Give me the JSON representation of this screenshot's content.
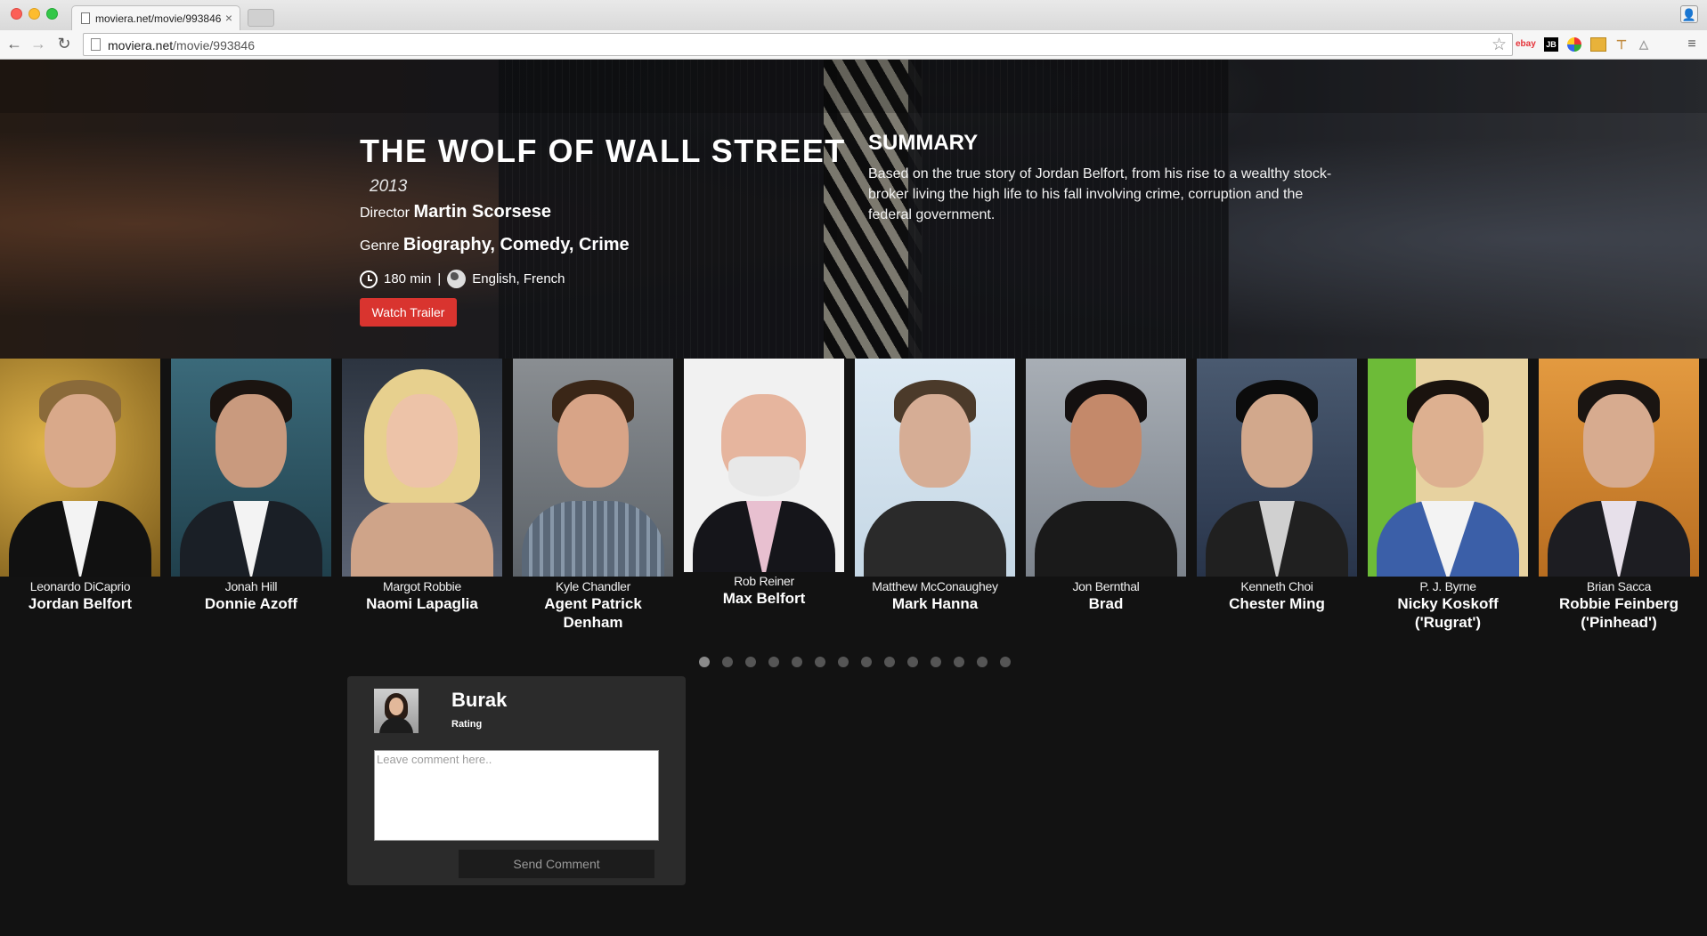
{
  "browser": {
    "tab_title": "moviera.net/movie/993846",
    "url_host": "moviera.net",
    "url_path": "/movie/993846"
  },
  "movie": {
    "title": "THE WOLF OF WALL STREET",
    "year": "2013",
    "director_label": "Director",
    "director": "Martin Scorsese",
    "genre_label": "Genre",
    "genre": "Biography, Comedy, Crime",
    "runtime": "180 min",
    "separator": "|",
    "languages": "English, French",
    "trailer_button": "Watch Trailer",
    "summary_title": "SUMMARY",
    "summary": "Based on the true story of Jordan Belfort, from his rise to a wealthy stock-broker living the high life to his fall involving crime, corruption and the federal government."
  },
  "cast": [
    {
      "actor": "Leonardo DiCaprio",
      "role": "Jordan Belfort"
    },
    {
      "actor": "Jonah Hill",
      "role": "Donnie Azoff"
    },
    {
      "actor": "Margot Robbie",
      "role": "Naomi Lapaglia"
    },
    {
      "actor": "Kyle Chandler",
      "role": "Agent Patrick Denham"
    },
    {
      "actor": "Rob Reiner",
      "role": "Max Belfort"
    },
    {
      "actor": "Matthew McConaughey",
      "role": "Mark Hanna"
    },
    {
      "actor": "Jon Bernthal",
      "role": "Brad"
    },
    {
      "actor": "Kenneth Choi",
      "role": "Chester Ming"
    },
    {
      "actor": "P. J. Byrne",
      "role": "Nicky Koskoff ('Rugrat')"
    },
    {
      "actor": "Brian Sacca",
      "role": "Robbie Feinberg ('Pinhead')"
    }
  ],
  "carousel": {
    "pages": 14,
    "active": 1
  },
  "comment": {
    "user": "Burak",
    "rating_label": "Rating",
    "placeholder": "Leave comment here..",
    "send_button": "Send Comment"
  },
  "extensions": [
    "ebay",
    "JB"
  ],
  "colors": {
    "accent": "#d9342f",
    "page_bg": "#121212",
    "panel_bg": "#2b2b2b"
  }
}
